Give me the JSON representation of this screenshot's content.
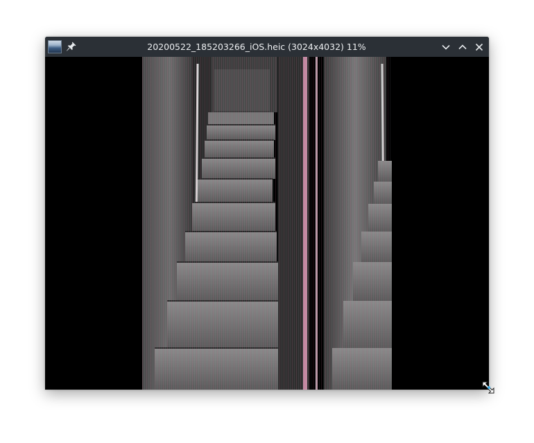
{
  "window": {
    "title": "20200522_185203266_iOS.heic (3024x4032) 11%",
    "app_icon": "image-viewer-thumbnail-icon",
    "buttons": {
      "pin": "pin-icon",
      "minimize": "chevron-down-icon",
      "maximize": "chevron-up-icon",
      "close": "close-icon"
    },
    "titlebar_color": "#2b3036",
    "background_color": "#000000"
  },
  "image": {
    "description_icon": "photo-of-staircase",
    "accent_colors": [
      "#c56b8f",
      "#6e6e6e"
    ]
  },
  "cursor": {
    "icon": "resize-diagonal-cursor-icon"
  }
}
